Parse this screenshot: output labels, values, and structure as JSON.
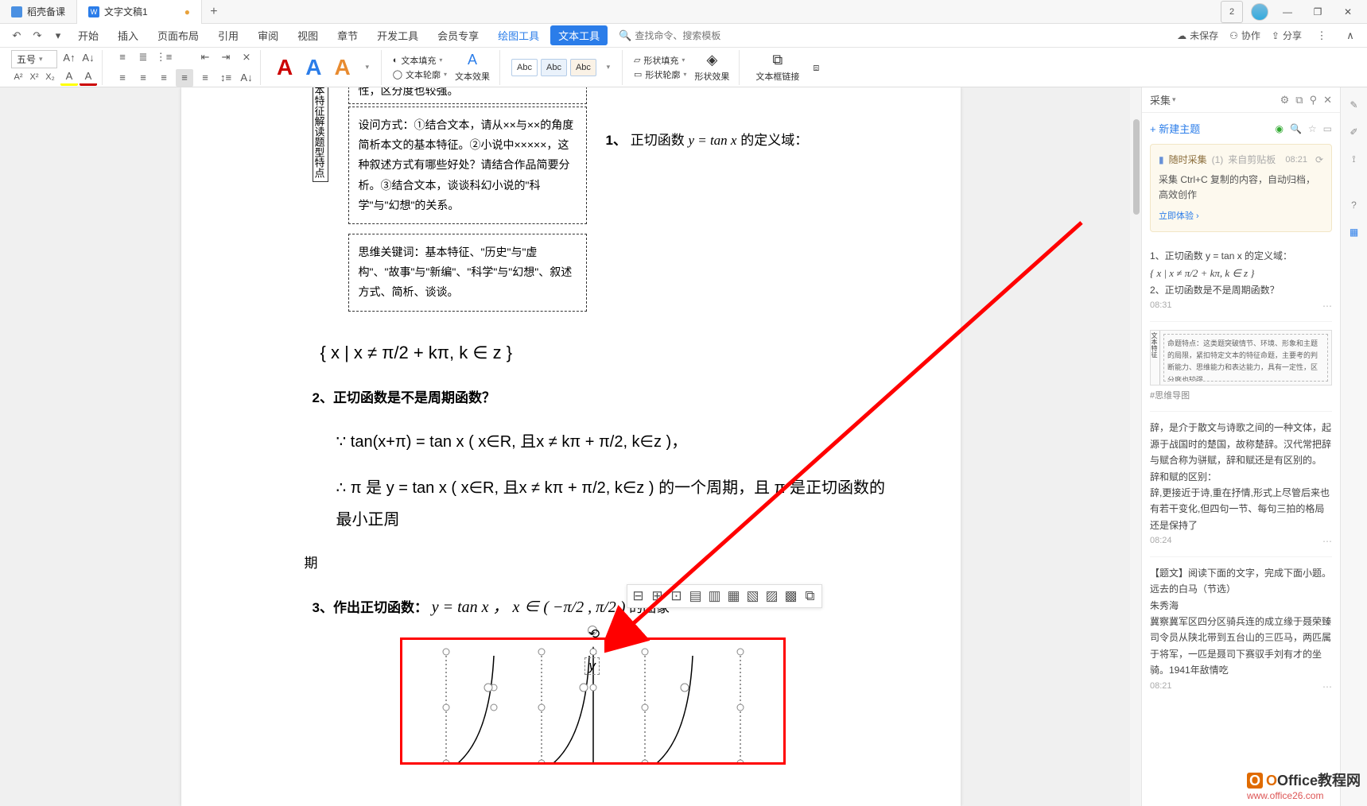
{
  "titlebar": {
    "tab1": "稻壳备课",
    "tab2": "文字文稿1",
    "badge_count": "2"
  },
  "menu": {
    "items": [
      "开始",
      "插入",
      "页面布局",
      "引用",
      "审阅",
      "视图",
      "章节",
      "开发工具",
      "会员专享"
    ],
    "context_tabs": {
      "draw": "绘图工具",
      "text": "文本工具"
    },
    "search_placeholder": "查找命令、搜索模板",
    "unsaved": "未保存",
    "collaborate": "协作",
    "share": "分享"
  },
  "ribbon": {
    "font_size": "五号",
    "text_fill": "文本填充",
    "text_outline": "文本轮廓",
    "text_effect": "文本效果",
    "abc": "Abc",
    "shape_fill": "形状填充",
    "shape_outline": "形状轮廓",
    "shape_effect": "形状效果",
    "text_box_link": "文本框链接"
  },
  "doc": {
    "spine_text": "本特征解读题型特点",
    "box1": "设问方式：①结合文本，请从××与××的角度简析本文的基本特征。②小说中×××××，这种叙述方式有哪些好处？请结合作品简要分析。③结合文本，谈谈科幻小说的\"科学\"与\"幻想\"的关系。",
    "box2": "思维关键词：基本特征、\"历史\"与\"虚构\"、\"故事\"与\"新编\"、\"科学\"与\"幻想\"、叙述方式、简析、谈谈。",
    "top_cut": "性，区分度也较强。",
    "q1_num": "1、",
    "q1_text": "正切函数 ",
    "q1_formula": "y = tan x",
    "q1_suffix": " 的定义域：",
    "set_expr": "{ x | x ≠ π/2 + kπ, k ∈ z }",
    "q2": "2、正切函数是不是周期函数？",
    "proof_line1": "∵ tan(x+π) = tan x ( x∈R, 且x ≠ kπ + π/2, k∈z )，",
    "proof_line2_a": "∴ π 是 y = tan x ( x∈R, 且x ≠ kπ + π/2, k∈z ) 的一个周期，且 π 是正切函数的最小正周",
    "proof_line2_b": "期",
    "q3_a": "3、作出正切函数：",
    "q3_formula": "y = tan x ， x ∈ ( −π/2 , π/2 )",
    "q3_b": " 的图象",
    "y_label": "y"
  },
  "panel": {
    "title": "采集",
    "new_topic": "+ 新建主题",
    "tip_title": "随时采集",
    "tip_count": "(1)",
    "tip_source": "来自剪贴板",
    "tip_time": "08:21",
    "tip_body": "采集 Ctrl+C 复制的内容，自动归档，高效创作",
    "try_now": "立即体验",
    "entry1_line1": "1、正切函数 y = tan x 的定义域：",
    "entry1_formula": "{ x | x ≠ π/2 + kπ, k ∈ z }",
    "entry1_line2": "2、正切函数是不是周期函数？",
    "entry1_time": "08:31",
    "entry2_thumb_text": "命题特点：这类题突破情节、环境、形象和主题的局限，紧扣特定文本的特征命题，主要考的判断能力、思维能力和表达能力，具有一定性，区分度也较强。",
    "entry2_thumb_spine": "文本特征",
    "entry2_tag": "#思维导图",
    "entry3_body": "辞，是介于散文与诗歌之间的一种文体，起源于战国时的楚国，故称楚辞。汉代常把辞与赋合称为骈赋，辞和赋还是有区别的。\n辞和赋的区别：\n辞,更接近于诗,重在抒情,形式上尽管后来也有若干变化,但四句一节、每句三拍的格局还是保持了",
    "entry3_time": "08:24",
    "entry4_l1": "【题文】阅读下面的文字，完成下面小题。",
    "entry4_l2": "远去的白马（节选）",
    "entry4_l3": "朱秀海",
    "entry4_l4": "冀察冀军区四分区骑兵连的成立缘于聂荣臻司令员从陕北带到五台山的三匹马，两匹属于将军，一匹是聂司下赛驭手刘有才的坐骑。1941年敌情吃",
    "entry4_time": "08:21"
  },
  "watermark": {
    "text": "Office教程网",
    "url": "www.office26.com"
  }
}
